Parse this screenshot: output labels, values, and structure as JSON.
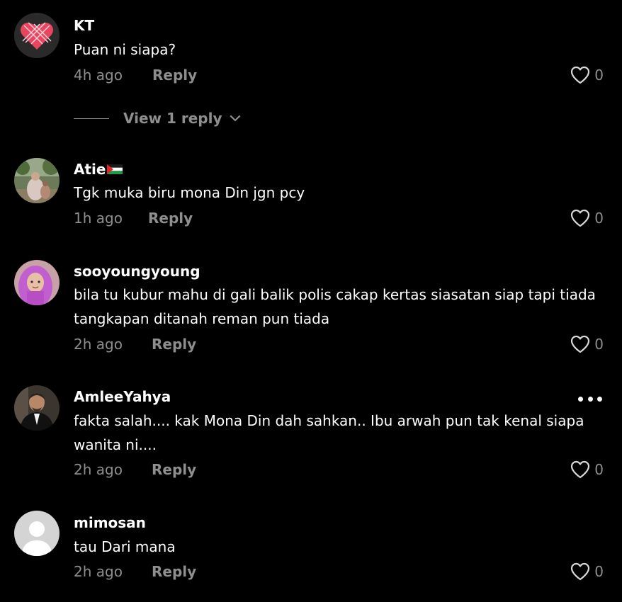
{
  "comments": [
    {
      "username": "KT",
      "text": "Puan ni siapa?",
      "time": "4h ago",
      "reply_label": "Reply",
      "likes": "0",
      "view_replies": "View 1 reply"
    },
    {
      "username": "Atie",
      "text": "Tgk muka biru mona Din jgn pcy",
      "time": "1h ago",
      "reply_label": "Reply",
      "likes": "0"
    },
    {
      "username": "sooyoungyoung",
      "text": "bila tu kubur mahu di gali balik polis cakap kertas siasatan siap tapi tiada tangkapan ditanah reman pun tiada",
      "time": "2h ago",
      "reply_label": "Reply",
      "likes": "0"
    },
    {
      "username": "AmleeYahya",
      "text": "fakta salah.... kak Mona Din dah sahkan.. Ibu arwah pun tak kenal siapa wanita ni....",
      "time": "2h ago",
      "reply_label": "Reply",
      "likes": "0"
    },
    {
      "username": "mimosan",
      "text": "tau Dari mana",
      "time": "2h ago",
      "reply_label": "Reply",
      "likes": "0"
    }
  ],
  "colors": {
    "background": "#000000",
    "primary_text": "#ffffff",
    "secondary_text": "#8e8e8e"
  },
  "icons": [
    "heart-outline-icon",
    "chevron-down-icon",
    "more-options-icon",
    "palestine-flag-icon",
    "default-avatar-icon"
  ]
}
